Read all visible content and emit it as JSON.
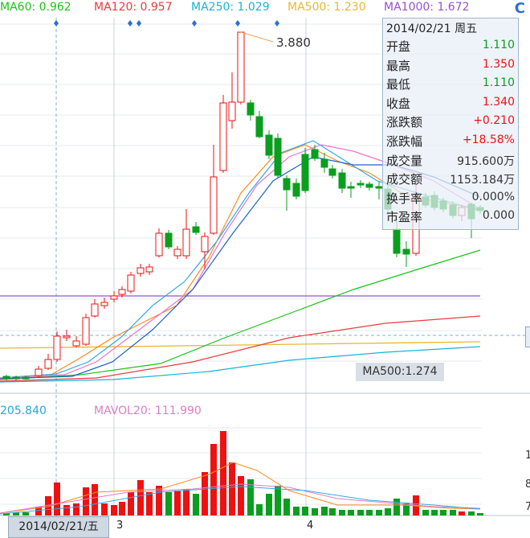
{
  "legend": {
    "ma60": "MA60: 0.962",
    "ma120": "MA120: 0.957",
    "ma250": "MA250: 1.029",
    "ma500": "MA500: 1.230",
    "ma1000": "MA1000: 1.672"
  },
  "colors": {
    "ma60": "#19c419",
    "ma120": "#ee3a3a",
    "ma250": "#17b3d6",
    "ma500": "#e8b830",
    "ma1000": "#9a4fd1",
    "up": "#ee1111",
    "down": "#0a9e1e",
    "ma5": "#ff8a1f",
    "ma10": "#33a9e0",
    "ma20": "#e875d2",
    "ma30": "#1f62c9"
  },
  "refresh_icon": "C",
  "max_annotation": "3.880",
  "info": {
    "date": "2014/02/21 周五",
    "rows": [
      {
        "label": "开盘",
        "value": "1.110",
        "color": "#0a9e1e"
      },
      {
        "label": "最高",
        "value": "1.350",
        "color": "#ee1111"
      },
      {
        "label": "最低",
        "value": "1.110",
        "color": "#0a9e1e"
      },
      {
        "label": "收盘",
        "value": "1.340",
        "color": "#ee1111"
      },
      {
        "label": "涨跌额",
        "value": "+0.210",
        "color": "#ee1111"
      },
      {
        "label": "涨跌幅",
        "value": "+18.58%",
        "color": "#ee1111"
      },
      {
        "label": "成交量",
        "value": "915.600万",
        "color": "#333333"
      },
      {
        "label": "成交额",
        "value": "1153.184万",
        "color": "#333333"
      },
      {
        "label": "换手率",
        "value": "0.000%",
        "color": "#333333"
      },
      {
        "label": "市盈率",
        "value": "0.000",
        "color": "#333333"
      }
    ]
  },
  "ma500_tag": "MA500:1.274",
  "volume_legend": {
    "left_value": "205.840",
    "mavol20": "MAVOL20: 111.990"
  },
  "date_box": "2014/02/21/五",
  "month_labels": [
    "3",
    "4"
  ],
  "right_edge_labels": [
    "1",
    "8",
    "7"
  ]
}
